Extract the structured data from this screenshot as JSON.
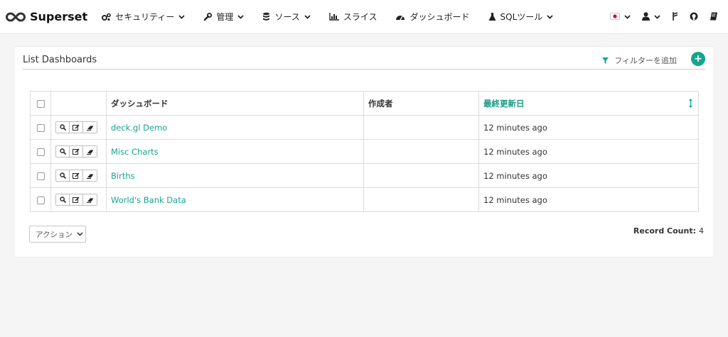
{
  "brand": {
    "name": "Superset"
  },
  "nav": {
    "items": [
      {
        "label": "セキュリティー",
        "icon": "cogs-icon",
        "dropdown": true
      },
      {
        "label": "管理",
        "icon": "wrench-icon",
        "dropdown": true
      },
      {
        "label": "ソース",
        "icon": "database-icon",
        "dropdown": true
      },
      {
        "label": "スライス",
        "icon": "bar-chart-icon",
        "dropdown": false
      },
      {
        "label": "ダッシュボード",
        "icon": "dashboard-icon",
        "dropdown": false
      },
      {
        "label": "SQLツール",
        "icon": "flask-icon",
        "dropdown": true
      }
    ],
    "right": [
      "language-flag-icon",
      "user-icon",
      "version-icon",
      "github-icon",
      "docs-icon"
    ]
  },
  "panel": {
    "title": "List Dashboards",
    "filter_label": "フィルターを追加",
    "add_label": "+"
  },
  "table": {
    "headers": {
      "name": "ダッシュボード",
      "creator": "作成者",
      "modified": "最終更新日"
    },
    "rows": [
      {
        "name": "deck.gl Demo",
        "creator": "",
        "modified": "12 minutes ago"
      },
      {
        "name": "Misc Charts",
        "creator": "",
        "modified": "12 minutes ago"
      },
      {
        "name": "Births",
        "creator": "",
        "modified": "12 minutes ago"
      },
      {
        "name": "World's Bank Data",
        "creator": "",
        "modified": "12 minutes ago"
      }
    ]
  },
  "footer": {
    "actions_label": "アクション",
    "record_count_label": "Record Count:",
    "record_count_value": "4"
  },
  "colors": {
    "accent": "#17a58e",
    "link": "#17a58e"
  }
}
